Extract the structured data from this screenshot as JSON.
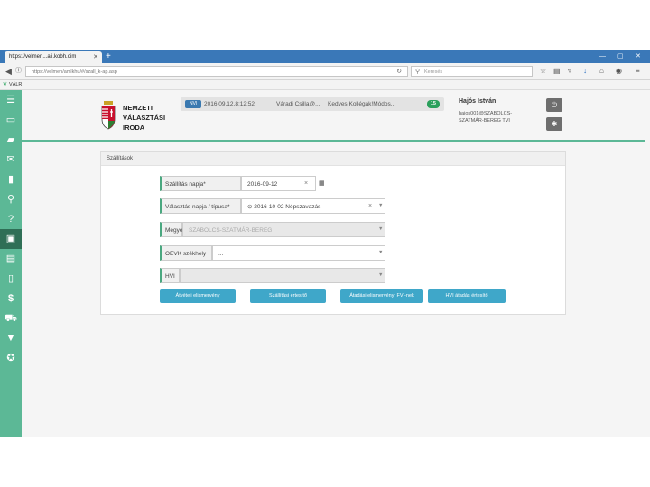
{
  "browser": {
    "tab_title": "https://velmen...ali.kobh.oim",
    "tab_close": "✕",
    "new_tab": "+",
    "url": "https://velmen/amlkhu/#/szall_k-ap.asp",
    "search_placeholder": "Keresés",
    "bookmark": "VÁLR",
    "controls": [
      "—",
      "▢",
      "✕"
    ]
  },
  "sidebar": {
    "items": [
      {
        "icon": "list-icon",
        "glyph": "☰"
      },
      {
        "icon": "monitor-icon",
        "glyph": "▭"
      },
      {
        "icon": "chat-icon",
        "glyph": "▰"
      },
      {
        "icon": "envelope-icon",
        "glyph": "✉"
      },
      {
        "icon": "book-icon",
        "glyph": "▮"
      },
      {
        "icon": "sitemap-icon",
        "glyph": "⚲"
      },
      {
        "icon": "question-icon",
        "glyph": "?"
      },
      {
        "icon": "briefcase-icon",
        "glyph": "▣"
      },
      {
        "icon": "table-icon",
        "glyph": "▤"
      },
      {
        "icon": "clipboard-icon",
        "glyph": "▯"
      },
      {
        "icon": "dollar-icon",
        "glyph": "$"
      },
      {
        "icon": "truck-icon",
        "glyph": "⛟"
      },
      {
        "icon": "filter-icon",
        "glyph": "▼"
      },
      {
        "icon": "accessibility-icon",
        "glyph": "✪"
      }
    ]
  },
  "header": {
    "logo_lines": [
      "NEMZETI",
      "VÁLASZTÁSI",
      "IRODA"
    ],
    "notification": {
      "tag": "NVI",
      "time": "2016.09.12.8:12:52",
      "sender": "Váradi Csilla@...",
      "subject": "Kedves Kollégák!Módos...",
      "count": "15"
    },
    "user": {
      "name": "Hajós István",
      "email": "hajos001@SZABOLCS-",
      "office": "SZATMÁR-BEREG TVI"
    }
  },
  "panel": {
    "title": "Szállítások",
    "fields": [
      {
        "label": "Szállítás napja*",
        "value": "2016-09-12"
      },
      {
        "label": "Választás napja / típusa*",
        "value": "⊙ 2016-10-02 Népszavazás"
      },
      {
        "label": "Megye*",
        "value": "SZABOLCS-SZATMÁR-BEREG"
      },
      {
        "label": "OEVK székhely",
        "value": "..."
      },
      {
        "label": "HVI",
        "value": ""
      }
    ],
    "buttons": [
      "Átvételi elismervény",
      "Szállítási értesítő",
      "Átadási elismervény: FVI-nek",
      "HVI átadás értesítő"
    ]
  },
  "colors": {
    "sidebar": "#5cb896",
    "sidebar_active": "#2f6f56",
    "button": "#3fa7c9",
    "tab_strip": "#3a78b8"
  }
}
